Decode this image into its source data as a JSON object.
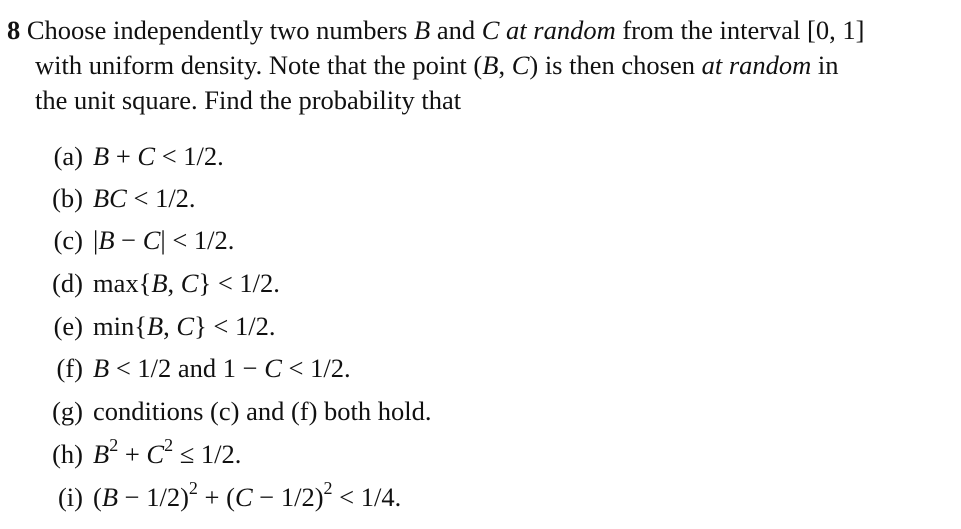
{
  "problem": {
    "number": "8",
    "intro_lines": [
      {
        "segments": [
          {
            "t": "Choose independently two numbers ",
            "s": "n"
          },
          {
            "t": "B",
            "s": "i"
          },
          {
            "t": " and ",
            "s": "n"
          },
          {
            "t": "C",
            "s": "i"
          },
          {
            "t": " at random",
            "s": "i"
          },
          {
            "t": " from the interval [0, 1]",
            "s": "n"
          }
        ]
      },
      {
        "segments": [
          {
            "t": "with uniform density. Note that the point (",
            "s": "n"
          },
          {
            "t": "B",
            "s": "i"
          },
          {
            "t": ", ",
            "s": "n"
          },
          {
            "t": "C",
            "s": "i"
          },
          {
            "t": ") is then chosen ",
            "s": "n"
          },
          {
            "t": "at random",
            "s": "i"
          },
          {
            "t": " in",
            "s": "n"
          }
        ]
      },
      {
        "segments": [
          {
            "t": "the unit square. Find the probability that",
            "s": "n"
          }
        ]
      }
    ],
    "parts": [
      {
        "label": "(a)",
        "html": "<i>B</i> + <i>C</i> &lt; 1/2."
      },
      {
        "label": "(b)",
        "html": "<i>BC</i> &lt; 1/2."
      },
      {
        "label": "(c)",
        "html": "|<i>B</i> − <i>C</i>| &lt; 1/2."
      },
      {
        "label": "(d)",
        "html": "max{<i>B</i>, <i>C</i>} &lt; 1/2."
      },
      {
        "label": "(e)",
        "html": "min{<i>B</i>, <i>C</i>} &lt; 1/2."
      },
      {
        "label": "(f)",
        "html": "<i>B</i> &lt; 1/2 and 1 − <i>C</i> &lt; 1/2."
      },
      {
        "label": "(g)",
        "html": "conditions (c) and (f) both hold."
      },
      {
        "label": "(h)",
        "html": "<i>B</i><sup>2</sup> + <i>C</i><sup>2</sup> ≤ 1/2."
      },
      {
        "label": "(i)",
        "html": "(<i>B</i> − 1/2)<sup>2</sup> + (<i>C</i> − 1/2)<sup>2</sup> &lt; 1/4."
      }
    ]
  }
}
